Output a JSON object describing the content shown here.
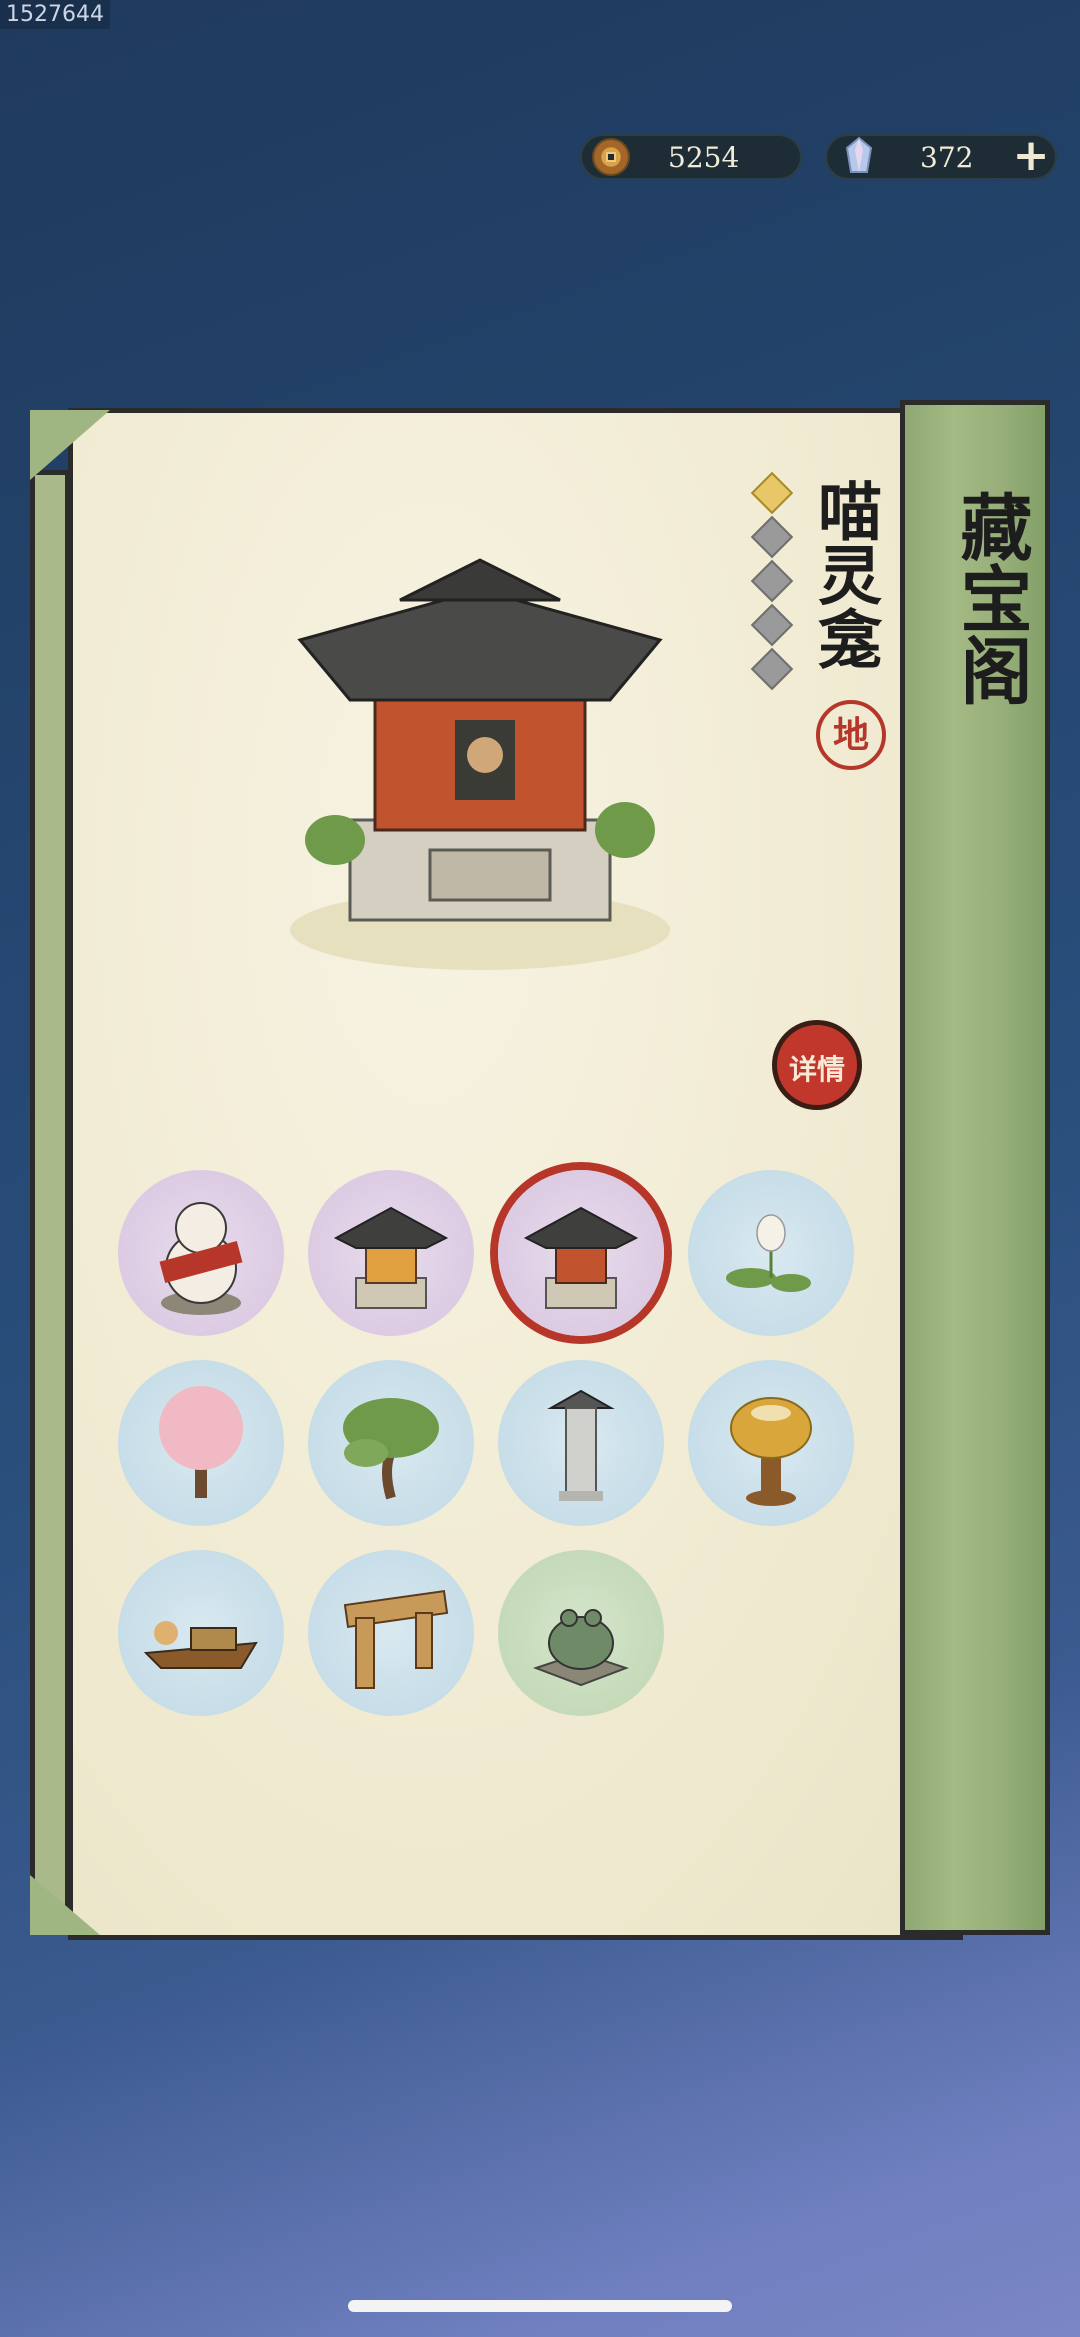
{
  "build_id": "1527644",
  "resources": {
    "coins": {
      "icon": "copper-coin-icon",
      "value": "5254"
    },
    "gems": {
      "icon": "crystal-gem-icon",
      "value": "372",
      "add_icon": "plus-icon"
    }
  },
  "panel": {
    "title": "藏宝阁",
    "item_name": "喵灵龛",
    "rarity_seal": "地",
    "stars": {
      "filled": 1,
      "total": 5
    },
    "detail_button": "详情"
  },
  "items": [
    {
      "name": "lucky-cat-statue",
      "bg": "purple"
    },
    {
      "name": "shrine-small",
      "bg": "purple"
    },
    {
      "name": "cat-shrine",
      "bg": "purple",
      "selected": true
    },
    {
      "name": "lotus-flower",
      "bg": "blue"
    },
    {
      "name": "cherry-blossom-tree",
      "bg": "blue"
    },
    {
      "name": "pine-tree",
      "bg": "blue"
    },
    {
      "name": "stone-lantern",
      "bg": "blue"
    },
    {
      "name": "golden-lotus-incense",
      "bg": "blue"
    },
    {
      "name": "flower-boat",
      "bg": "blue"
    },
    {
      "name": "wooden-gate",
      "bg": "blue"
    },
    {
      "name": "frog-statue",
      "bg": "green"
    }
  ],
  "colors": {
    "accent_red": "#c2372c",
    "scroll_green": "#a4ba84",
    "paper": "#f1ebd3"
  }
}
